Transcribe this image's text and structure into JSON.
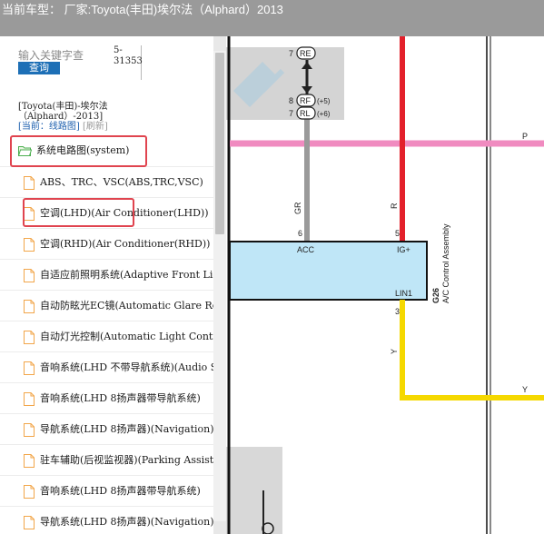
{
  "title_bar": {
    "text": "当前车型：  厂家:Toyota(丰田)埃尔法（Alphard）2013"
  },
  "search": {
    "placeholder": "输入关键字查",
    "button_label": "查询",
    "count_line1": "5-",
    "count_line2": "31353"
  },
  "vehicle_info": {
    "line1": "[Toyota(丰田)-埃尔法",
    "line2": "（Alphard）-2013]",
    "current_prefix": "[当前：",
    "current_value": "线路图",
    "current_suffix": "]",
    "refresh_label": "[刷新]"
  },
  "tree": {
    "root_label": "系统电路图(system)",
    "items": [
      {
        "label": "ABS、TRC、VSC(ABS,TRC,VSC)"
      },
      {
        "label": "空调(LHD)(Air Conditioner(LHD))"
      },
      {
        "label": "空调(RHD)(Air Conditioner(RHD))"
      },
      {
        "label": "自适应前照明系统(Adaptive Front Lighting)"
      },
      {
        "label": "自动防眩光EC镜(Automatic Glare Resistant EC Mirror)"
      },
      {
        "label": "自动灯光控制(Automatic Light Control)"
      },
      {
        "label": "音响系统(LHD 不带导航系统)(Audio System)"
      },
      {
        "label": "音响系统(LHD 8扬声器带导航系统)"
      },
      {
        "label": "导航系统(LHD 8扬声器)(Navigation)"
      },
      {
        "label": "驻车辅助(后视监视器)(Parking Assist)"
      },
      {
        "label": "音响系统(LHD 8扬声器带导航系统)"
      },
      {
        "label": "导航系统(LHD 8扬声器)(Navigation)"
      }
    ]
  },
  "colors": {
    "title_bar_bg": "#9a9a9a",
    "highlight_border": "#e0444f",
    "button_bg": "#1d6fb6",
    "wire_red": "#e3202b",
    "wire_yellow": "#f5d800",
    "wire_pink": "#f08bc0",
    "wire_gray": "#9a9a9a",
    "connector_fill": "#bfe6f7",
    "folder_green": "#4caf50",
    "doc_orange": "#f2a64a"
  },
  "diagram": {
    "pins": {
      "re_num": "7",
      "re_code": "RE",
      "rf_num": "8",
      "rf_code": "RF",
      "rf_suffix": "(+5)",
      "rl_num": "7",
      "rl_code": "RL",
      "rl_suffix": "(+6)"
    },
    "wire_labels": {
      "pink": "P",
      "gray": "GR",
      "red": "R",
      "yellow_left": "Y",
      "yellow_right": "Y"
    },
    "connector": {
      "pin_acc_num": "6",
      "pin_acc": "ACC",
      "pin_ig_num": "5",
      "pin_ig": "IG+",
      "pin_lin_num": "3",
      "pin_lin": "LIN1",
      "code": "G26",
      "name": "A/C Control Assembly"
    },
    "icons": [
      "watermark-logo",
      "bidirectional-arrow-icon"
    ]
  }
}
